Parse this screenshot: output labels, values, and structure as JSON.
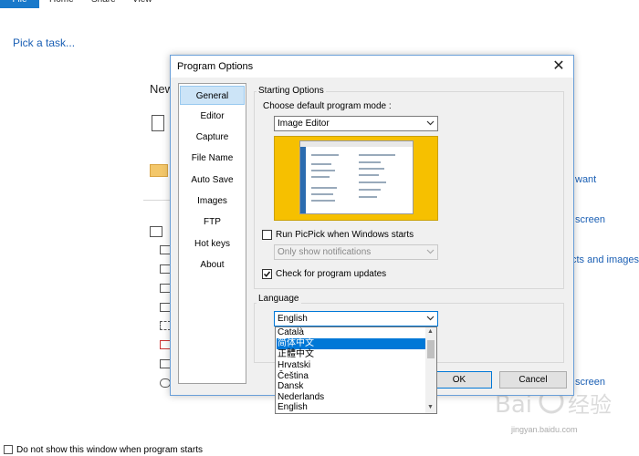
{
  "ribbon": {
    "file_label": "File",
    "tabs": [
      "Home",
      "Share",
      "View"
    ]
  },
  "main": {
    "pick_task": "Pick a task...",
    "section_new": "New",
    "links": [
      "want",
      "screen",
      "cts and images",
      "screen"
    ],
    "bottom_checkbox_label": "Do not show this window when program starts"
  },
  "dialog": {
    "title": "Program Options",
    "close_glyph": "✕",
    "nav_items": [
      "General",
      "Editor",
      "Capture",
      "File Name",
      "Auto Save",
      "Images",
      "FTP",
      "Hot keys",
      "About"
    ],
    "active_nav": "General",
    "starting_options": {
      "group_label": "Starting Options",
      "mode_label": "Choose default program mode :",
      "mode_value": "Image Editor",
      "run_at_startup_label": "Run PicPick when Windows starts",
      "run_at_startup_checked": false,
      "startup_behavior_value": "Only show notifications",
      "check_updates_label": "Check for program updates",
      "check_updates_checked": true
    },
    "language": {
      "group_label": "Language",
      "selected": "English",
      "options": [
        "Català",
        "简体中文",
        "正體中文",
        "Hrvatski",
        "Čeština",
        "Dansk",
        "Nederlands",
        "English"
      ],
      "highlighted": "简体中文"
    },
    "buttons": {
      "ok": "OK",
      "cancel": "Cancel"
    }
  },
  "watermark": {
    "brand": "Bai 经验",
    "url": "jingyan.baidu.com"
  },
  "colors": {
    "accent": "#0078d7",
    "file_tab": "#1979ca",
    "preview_bg": "#f6c000"
  }
}
